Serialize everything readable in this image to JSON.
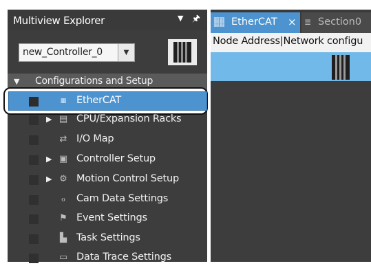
{
  "explorer": {
    "title": "Multiview Explorer",
    "header_dropdown_icon": "chevron-down-icon",
    "pin_icon": "pin-icon",
    "controller_select": {
      "value": "new_Controller_0"
    },
    "controller_device_icon": "controller-icon",
    "group": {
      "label": "Configurations and Setup",
      "expanded": true
    },
    "items": [
      {
        "label": "EtherCAT",
        "icon": "ethercat-icon",
        "expandable": false,
        "selected": true
      },
      {
        "label": "CPU/Expansion Racks",
        "icon": "rack-icon",
        "expandable": true,
        "selected": false
      },
      {
        "label": "I/O Map",
        "icon": "io-map-icon",
        "expandable": false,
        "selected": false
      },
      {
        "label": "Controller Setup",
        "icon": "controller-setup-icon",
        "expandable": true,
        "selected": false
      },
      {
        "label": "Motion Control Setup",
        "icon": "gear-icon",
        "expandable": true,
        "selected": false
      },
      {
        "label": "Cam Data Settings",
        "icon": "cam-icon",
        "expandable": false,
        "selected": false
      },
      {
        "label": "Event Settings",
        "icon": "flag-icon",
        "expandable": false,
        "selected": false
      },
      {
        "label": "Task Settings",
        "icon": "task-icon",
        "expandable": false,
        "selected": false
      },
      {
        "label": "Data Trace Settings",
        "icon": "trace-icon",
        "expandable": false,
        "selected": false
      }
    ],
    "selection_color": "#4d93cf"
  },
  "editor": {
    "tabs": [
      {
        "label": "EtherCAT",
        "icon": "ethercat-icon",
        "active": true,
        "close": "×"
      },
      {
        "label": "Section0",
        "icon": "section-icon",
        "active": false
      }
    ],
    "crumb": "Node Address|Network configu",
    "canvas_color": "#71b9e8"
  }
}
